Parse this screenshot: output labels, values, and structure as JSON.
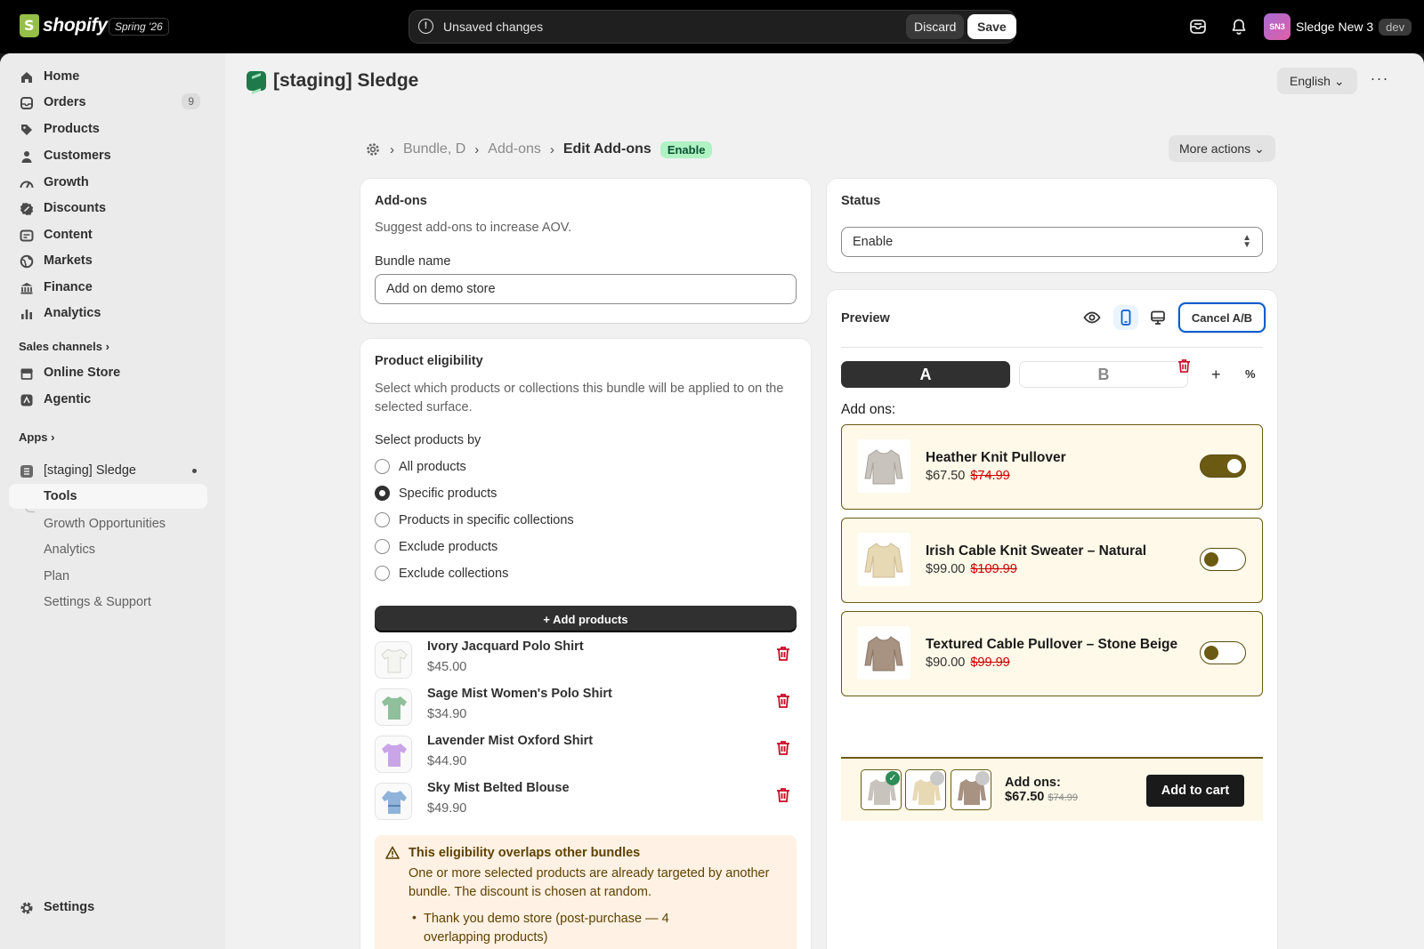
{
  "topbar": {
    "brand": "shopify",
    "edition": "Spring '26",
    "unsaved_text": "Unsaved changes",
    "discard_label": "Discard",
    "save_label": "Save",
    "store_initials": "SN3",
    "store_name": "Sledge New 3",
    "env_badge": "dev"
  },
  "sidebar": {
    "items": [
      {
        "label": "Home",
        "icon": "home-icon"
      },
      {
        "label": "Orders",
        "icon": "orders-icon",
        "badge": "9"
      },
      {
        "label": "Products",
        "icon": "tag-icon"
      },
      {
        "label": "Customers",
        "icon": "person-icon"
      },
      {
        "label": "Growth",
        "icon": "growth-icon"
      },
      {
        "label": "Discounts",
        "icon": "discount-icon"
      },
      {
        "label": "Content",
        "icon": "content-icon"
      },
      {
        "label": "Markets",
        "icon": "globe-icon"
      },
      {
        "label": "Finance",
        "icon": "bank-icon"
      },
      {
        "label": "Analytics",
        "icon": "chart-icon"
      }
    ],
    "sales_channels_label": "Sales channels",
    "channels": [
      {
        "label": "Online Store",
        "icon": "store-icon"
      },
      {
        "label": "Agentic",
        "icon": "agentic-icon"
      }
    ],
    "apps_label": "Apps",
    "app_name": "[staging] Sledge",
    "app_subitems": [
      "Tools",
      "Growth Opportunities",
      "Analytics",
      "Plan",
      "Settings & Support"
    ],
    "settings_label": "Settings"
  },
  "header": {
    "app_title": "[staging] Sledge",
    "language": "English",
    "more_label": "···"
  },
  "breadcrumb": {
    "items": [
      "Bundle, D",
      "Add-ons"
    ],
    "current": "Edit Add-ons",
    "status_badge": "Enable",
    "more_actions": "More actions"
  },
  "addons_card": {
    "title": "Add-ons",
    "subtitle": "Suggest add-ons to increase AOV.",
    "bundle_name_label": "Bundle name",
    "bundle_name_value": "Add on demo store"
  },
  "eligibility": {
    "title": "Product eligibility",
    "description": "Select which products or collections this bundle will be applied to on the selected surface.",
    "select_by_label": "Select products by",
    "options": [
      "All products",
      "Specific products",
      "Products in specific collections",
      "Exclude products",
      "Exclude collections"
    ],
    "selected_option": "Specific products",
    "add_products_label": "Add products",
    "products": [
      {
        "name": "Ivory Jacquard Polo Shirt",
        "price": "$45.00",
        "color": "#f4f4f0"
      },
      {
        "name": "Sage Mist Women's Polo Shirt",
        "price": "$34.90",
        "color": "#8fbf9b"
      },
      {
        "name": "Lavender Mist Oxford Shirt",
        "price": "$44.90",
        "color": "#c9a4e6"
      },
      {
        "name": "Sky Mist Belted Blouse",
        "price": "$49.90",
        "color": "#8fb3d9"
      }
    ],
    "warning": {
      "title": "This eligibility overlaps other bundles",
      "body": "One or more selected products are already targeted by another bundle. The discount is chosen at random.",
      "bullet_link": "Thank you demo store",
      "bullet_rest": " (post-purchase — 4 overlapping products)"
    }
  },
  "status_card": {
    "title": "Status",
    "value": "Enable"
  },
  "preview": {
    "title": "Preview",
    "cancel_ab_label": "Cancel A/B",
    "variant_a": "A",
    "variant_b": "B",
    "add_ons_heading": "Add ons:",
    "addons": [
      {
        "name": "Heather Knit Pullover",
        "price": "$67.50",
        "old_price": "$74.99",
        "enabled": true,
        "color": "#c8c4bd"
      },
      {
        "name": "Irish Cable Knit Sweater – Natural",
        "price": "$99.00",
        "old_price": "$109.99",
        "enabled": false,
        "color": "#e8d9b5"
      },
      {
        "name": "Textured Cable Pullover – Stone Beige",
        "price": "$90.00",
        "old_price": "$99.99",
        "enabled": false,
        "color": "#a89282"
      }
    ],
    "sticky": {
      "label": "Add ons:",
      "price": "$67.50",
      "old_price": "$74.99",
      "cta": "Add to cart"
    }
  },
  "colors": {
    "accent_dark": "#303030",
    "success_badge": "#aff2c3",
    "addon_gold": "#6b5a12",
    "addon_bg": "#fef9e8",
    "strike_red": "#cc0000",
    "focus_blue": "#005bd3",
    "trash_red": "#c70a24"
  }
}
